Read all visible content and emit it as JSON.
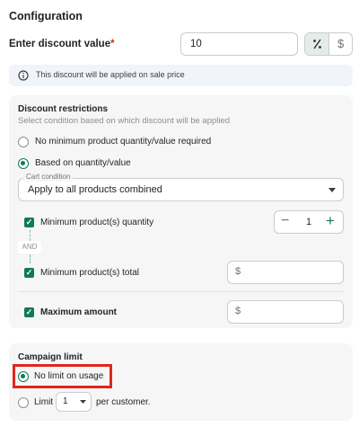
{
  "config": {
    "title": "Configuration",
    "discount_label": "Enter discount value",
    "required_mark": "*",
    "discount_value": "10",
    "percent_icon": "percent-icon",
    "dollar_icon": "dollar-icon",
    "info_text": "This discount will be applied on sale price"
  },
  "restrictions": {
    "title": "Discount restrictions",
    "subtitle": "Select condition based on which discount will be applied",
    "option_none": "No minimum product quantity/value required",
    "option_based": "Based on quantity/value",
    "cart_condition_label": "Cart condition",
    "cart_condition_value": "Apply to all products combined",
    "min_qty_label": "Minimum product(s) quantity",
    "min_qty_value": "1",
    "and_label": "AND",
    "min_total_label": "Minimum product(s) total",
    "min_total_prefix": "$",
    "max_amount_label": "Maximum amount",
    "max_amount_prefix": "$"
  },
  "campaign": {
    "title": "Campaign limit",
    "no_limit_label": "No limit on usage",
    "limit_label": "Limit",
    "limit_value": "1",
    "per_customer": "per customer."
  },
  "colors": {
    "accent": "#0f7a5a",
    "highlight_box": "#e0271f"
  }
}
